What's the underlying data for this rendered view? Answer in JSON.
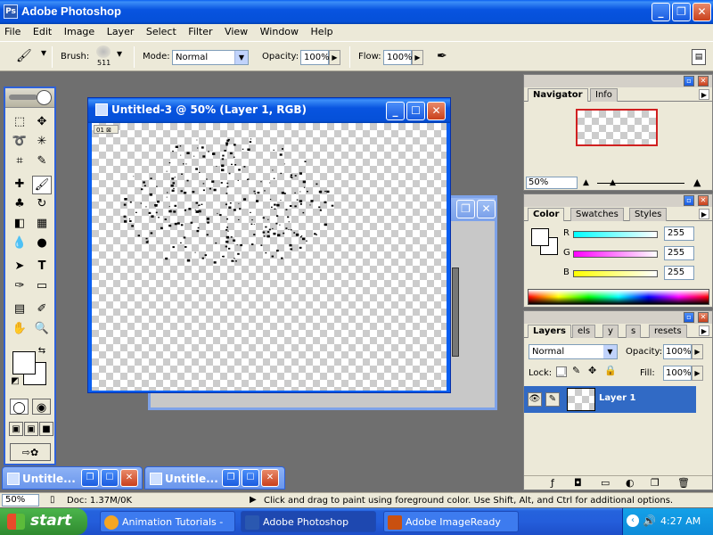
{
  "app": {
    "title": "Adobe Photoshop"
  },
  "menu": [
    "File",
    "Edit",
    "Image",
    "Layer",
    "Select",
    "Filter",
    "View",
    "Window",
    "Help"
  ],
  "options": {
    "brush_label": "Brush:",
    "brush_size": "511",
    "mode_label": "Mode:",
    "mode_value": "Normal",
    "opacity_label": "Opacity:",
    "opacity_value": "100%",
    "flow_label": "Flow:",
    "flow_value": "100%"
  },
  "document": {
    "title": "Untitled-3 @ 50% (Layer 1, RGB)",
    "tag": "01 ⊠"
  },
  "minimized_docs": [
    {
      "title": "Untitle..."
    },
    {
      "title": "Untitle..."
    }
  ],
  "navigator": {
    "tabs": [
      "Navigator",
      "Info"
    ],
    "zoom": "50%"
  },
  "color_panel": {
    "tabs": [
      "Color",
      "Swatches",
      "Styles"
    ],
    "channels": [
      {
        "label": "R",
        "value": "255",
        "color": "#00ffff"
      },
      {
        "label": "G",
        "value": "255",
        "color": "#ff00ff"
      },
      {
        "label": "B",
        "value": "255",
        "color": "#ffff00"
      }
    ]
  },
  "layers_panel": {
    "tabs": [
      "Layers",
      "els",
      "y",
      "s",
      "resets"
    ],
    "blend_mode": "Normal",
    "opacity_label": "Opacity:",
    "opacity_value": "100%",
    "lock_label": "Lock:",
    "fill_label": "Fill:",
    "fill_value": "100%",
    "layer_name": "Layer 1"
  },
  "status": {
    "zoom": "50%",
    "doc": "Doc: 1.37M/0K",
    "hint": "Click and drag to paint using foreground color.  Use Shift, Alt, and Ctrl for additional options."
  },
  "taskbar": {
    "start": "start",
    "tasks": [
      "Animation Tutorials - ...",
      "Adobe Photoshop",
      "Adobe ImageReady"
    ],
    "clock": "4:27 AM"
  }
}
